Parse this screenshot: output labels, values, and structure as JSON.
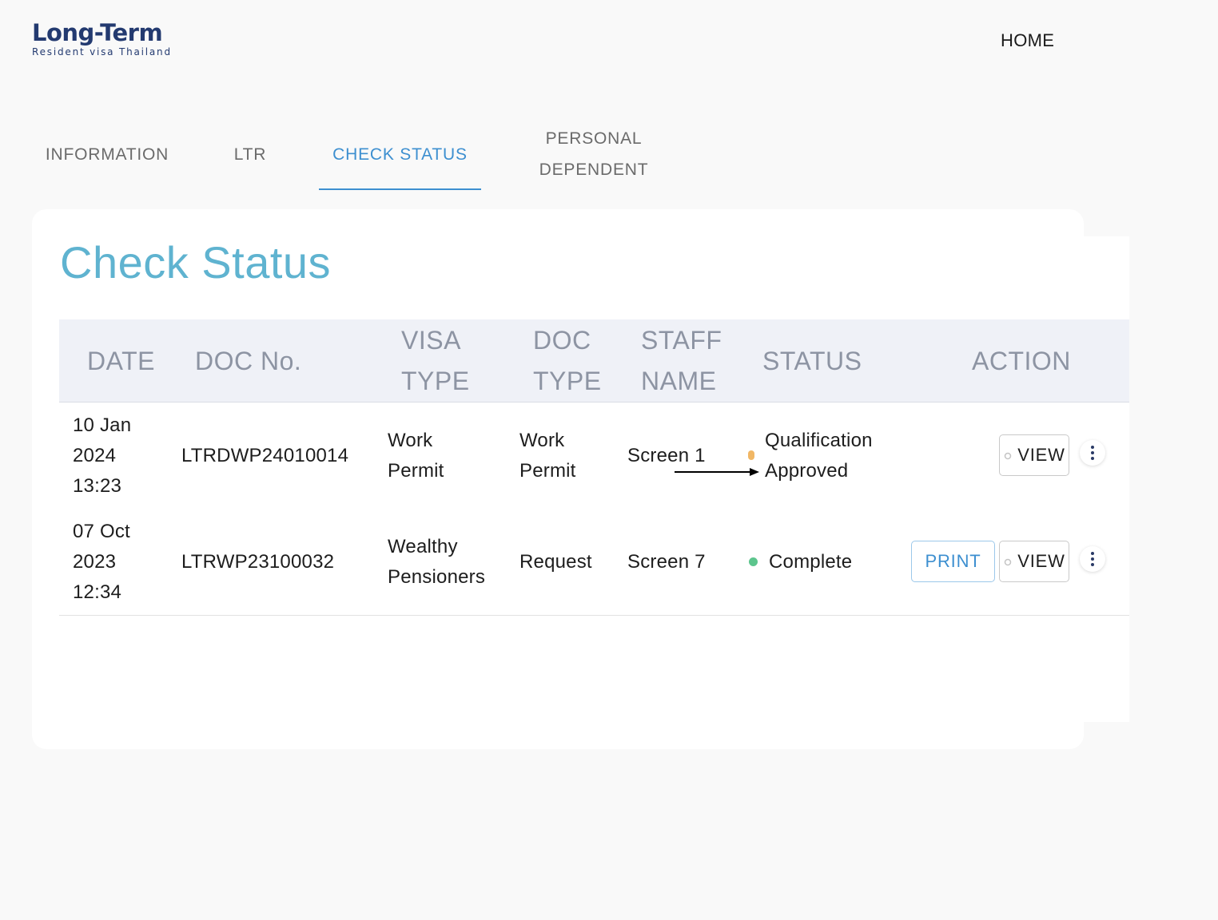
{
  "header": {
    "logo_title": "Long-Term",
    "logo_subtitle": "Resident visa Thailand",
    "home_label": "HOME"
  },
  "tabs": [
    {
      "label": "INFORMATION",
      "active": false
    },
    {
      "label": "LTR",
      "active": false
    },
    {
      "label": "CHECK STATUS",
      "active": true
    },
    {
      "label_line1": "PERSONAL",
      "label_line2": "DEPENDENT",
      "active": false
    }
  ],
  "main": {
    "title": "Check Status",
    "columns": [
      {
        "line1": "DATE",
        "line2": ""
      },
      {
        "line1": "DOC No.",
        "line2": ""
      },
      {
        "line1": "VISA",
        "line2": "TYPE"
      },
      {
        "line1": "DOC",
        "line2": "TYPE"
      },
      {
        "line1": "STAFF",
        "line2": "NAME"
      },
      {
        "line1": "STATUS",
        "line2": ""
      },
      {
        "line1": "ACTION",
        "line2": ""
      }
    ],
    "rows": [
      {
        "date_day": "10 Jan",
        "date_year": "2024",
        "date_time": "13:23",
        "doc_no": "LTRDWP24010014",
        "visa_type_l1": "Work",
        "visa_type_l2": "Permit",
        "doc_type_l1": "Work",
        "doc_type_l2": "Permit",
        "staff_name": "Screen 1",
        "status_l1": "Qualification",
        "status_l2": "Approved",
        "status_color": "#f1b765",
        "actions": [
          "VIEW"
        ]
      },
      {
        "date_day": "07 Oct",
        "date_year": "2023",
        "date_time": "12:34",
        "doc_no": "LTRWP23100032",
        "visa_type_l1": "Wealthy",
        "visa_type_l2": "Pensioners",
        "doc_type_l1": "Request",
        "doc_type_l2": "",
        "staff_name": "Screen 7",
        "status_l1": "Complete",
        "status_l2": "",
        "status_color": "#5cc58d",
        "actions": [
          "PRINT",
          "VIEW"
        ]
      }
    ]
  },
  "colors": {
    "accent": "#3d8fd0",
    "title": "#5fb3d0",
    "brand": "#233a70",
    "header_bg": "#eff1f7"
  },
  "icons": [
    "view-icon",
    "more-vertical-icon",
    "arrow-right-icon"
  ]
}
